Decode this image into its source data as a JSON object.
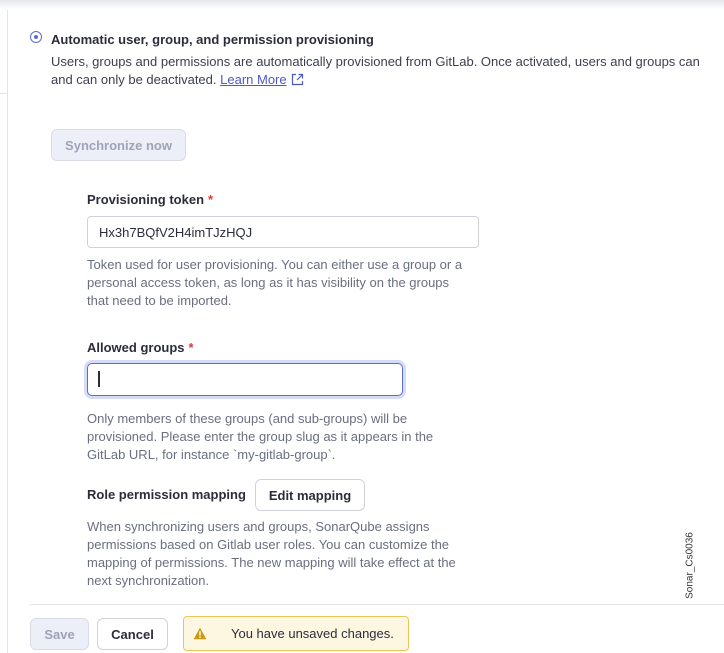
{
  "provisioning_option": {
    "title": "Automatic user, group, and permission provisioning",
    "description_line1": "Users, groups and permissions are automatically provisioned from GitLab. Once activated, users and groups can",
    "description_line2": "and can only be deactivated.",
    "learn_more_label": "Learn More",
    "selected": true
  },
  "synchronize_button": {
    "label": "Synchronize now",
    "enabled": false
  },
  "provisioning_token": {
    "label": "Provisioning token",
    "required_mark": "*",
    "value": "Hx3h7BQfV2H4imTJzHQJ",
    "help": [
      "Token used for user provisioning. You can either use a group or a",
      "personal access token, as long as it has visibility on the groups",
      "that need to be imported."
    ]
  },
  "allowed_groups": {
    "label": "Allowed groups",
    "required_mark": "*",
    "value": "",
    "help": [
      "Only members of these groups (and sub-groups) will be",
      "provisioned. Please enter the group slug as it appears in the",
      "GitLab URL, for instance `my-gitlab-group`."
    ]
  },
  "role_permission_mapping": {
    "label": "Role permission mapping",
    "edit_button_label": "Edit mapping",
    "help": [
      "When synchronizing users and groups, SonarQube assigns",
      "permissions based on Gitlab user roles. You can customize the",
      "mapping of permissions. The new mapping will take effect at the",
      "next synchronization."
    ]
  },
  "footer": {
    "save_label": "Save",
    "save_enabled": false,
    "cancel_label": "Cancel",
    "warning_text": "You have unsaved changes."
  },
  "side_caption": "Sonar_Cs0036",
  "colors": {
    "accent": "#5d6cd0",
    "link": "#4c5bc4",
    "required": "#d33a3a",
    "warning_border": "#e9c45a",
    "warning_bg": "#fdf6e0",
    "warning_icon": "#c99a14"
  },
  "icons": {
    "learn_more": "external-link-icon",
    "warning": "warning-triangle-icon"
  }
}
